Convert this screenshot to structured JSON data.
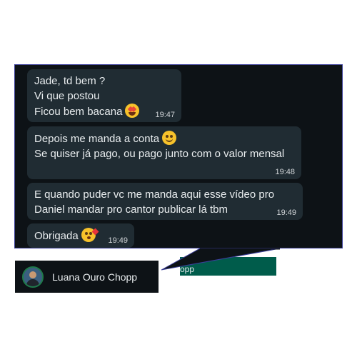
{
  "messages": [
    {
      "lines": [
        "Jade, td bem ?",
        "Vi que postou",
        "Ficou bem bacana"
      ],
      "emoji": "star-struck-emoji",
      "time": "19:47"
    },
    {
      "lines": [
        "Depois me manda a conta",
        "Se quiser já pago, ou pago junto com o valor mensal"
      ],
      "emoji": "smiling-blush-emoji",
      "time": "19:48"
    },
    {
      "lines": [
        "E quando puder vc me manda aqui esse vídeo pro",
        "Daniel mandar pro cantor publicar lá tbm"
      ],
      "time": "19:49"
    },
    {
      "lines": [
        "Obrigada"
      ],
      "emoji": "kissing-heart-emoji",
      "time": "19:49"
    }
  ],
  "partial_text": "opp",
  "contact": {
    "name": "Luana Ouro Chopp"
  },
  "colors": {
    "chat_background": "#0d1216",
    "bubble_incoming": "#202c33",
    "bubble_outgoing": "#005c4b",
    "panel_border": "#3b3f9a",
    "text": "#e9edef"
  }
}
